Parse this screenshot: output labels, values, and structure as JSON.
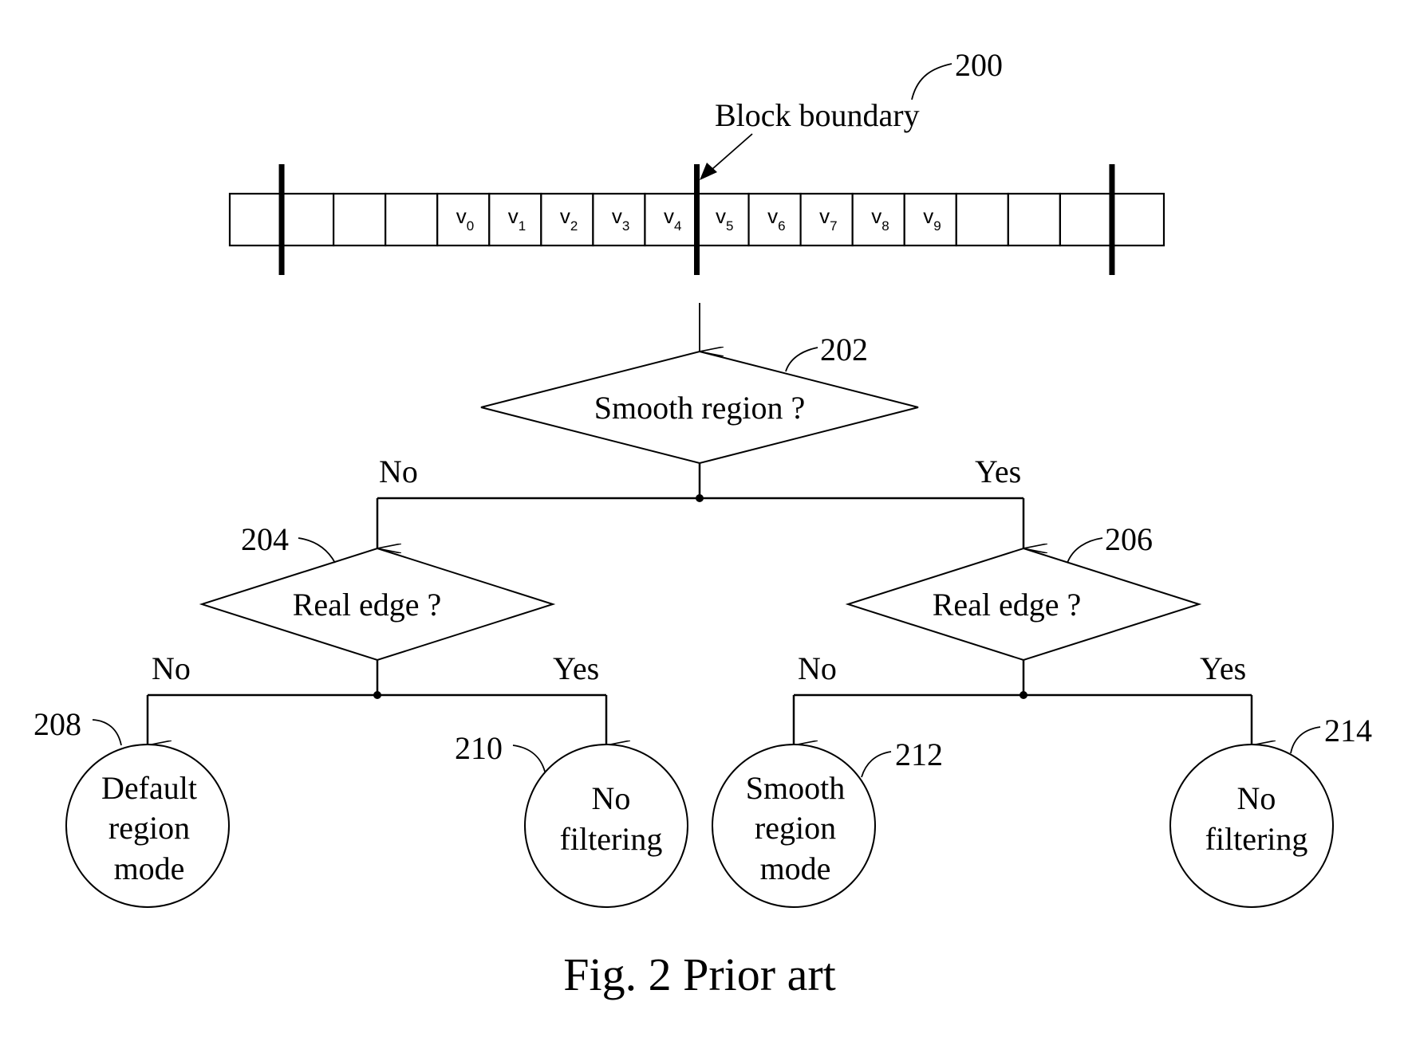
{
  "figure": {
    "caption": "Fig. 2 Prior art",
    "reference": "200",
    "boundary_label": "Block boundary"
  },
  "array": {
    "cells": [
      "",
      "",
      "",
      "",
      "v0",
      "v1",
      "v2",
      "v3",
      "v4",
      "v5",
      "v6",
      "v7",
      "v8",
      "v9",
      "",
      "",
      "",
      ""
    ],
    "cell_parts": [
      {
        "base": "",
        "sub": ""
      },
      {
        "base": "",
        "sub": ""
      },
      {
        "base": "",
        "sub": ""
      },
      {
        "base": "",
        "sub": ""
      },
      {
        "base": "v",
        "sub": "0"
      },
      {
        "base": "v",
        "sub": "1"
      },
      {
        "base": "v",
        "sub": "2"
      },
      {
        "base": "v",
        "sub": "3"
      },
      {
        "base": "v",
        "sub": "4"
      },
      {
        "base": "v",
        "sub": "5"
      },
      {
        "base": "v",
        "sub": "6"
      },
      {
        "base": "v",
        "sub": "7"
      },
      {
        "base": "v",
        "sub": "8"
      },
      {
        "base": "v",
        "sub": "9"
      },
      {
        "base": "",
        "sub": ""
      },
      {
        "base": "",
        "sub": ""
      },
      {
        "base": "",
        "sub": ""
      },
      {
        "base": "",
        "sub": ""
      }
    ],
    "block_boundaries_after_cell": [
      1,
      9,
      17
    ],
    "highlighted_boundary_index": 1
  },
  "nodes": {
    "n202": {
      "ref": "202",
      "type": "decision",
      "label": "Smooth region ?"
    },
    "n204": {
      "ref": "204",
      "type": "decision",
      "label": "Real edge ?"
    },
    "n206": {
      "ref": "206",
      "type": "decision",
      "label": "Real edge ?"
    },
    "n208": {
      "ref": "208",
      "type": "terminal",
      "lines": [
        "Default",
        "region",
        "mode"
      ]
    },
    "n210": {
      "ref": "210",
      "type": "terminal",
      "lines": [
        "No",
        "filtering"
      ]
    },
    "n212": {
      "ref": "212",
      "type": "terminal",
      "lines": [
        "Smooth",
        "region",
        "mode"
      ]
    },
    "n214": {
      "ref": "214",
      "type": "terminal",
      "lines": [
        "No",
        "filtering"
      ]
    }
  },
  "edges": [
    {
      "from": "array",
      "to": "n202",
      "label": ""
    },
    {
      "from": "n202",
      "to": "n204",
      "label": "No"
    },
    {
      "from": "n202",
      "to": "n206",
      "label": "Yes"
    },
    {
      "from": "n204",
      "to": "n208",
      "label": "No"
    },
    {
      "from": "n204",
      "to": "n210",
      "label": "Yes"
    },
    {
      "from": "n206",
      "to": "n212",
      "label": "No"
    },
    {
      "from": "n206",
      "to": "n214",
      "label": "Yes"
    }
  ]
}
